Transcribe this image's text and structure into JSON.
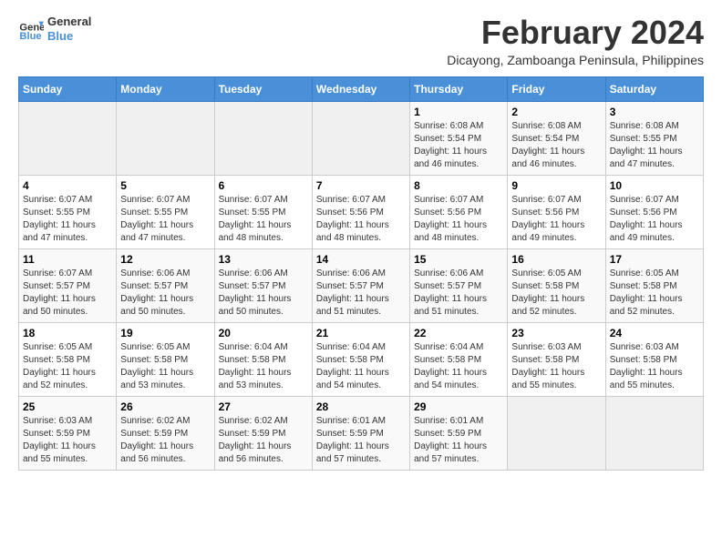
{
  "header": {
    "logo_line1": "General",
    "logo_line2": "Blue",
    "main_title": "February 2024",
    "subtitle": "Dicayong, Zamboanga Peninsula, Philippines"
  },
  "days_of_week": [
    "Sunday",
    "Monday",
    "Tuesday",
    "Wednesday",
    "Thursday",
    "Friday",
    "Saturday"
  ],
  "weeks": [
    [
      {
        "day": "",
        "info": ""
      },
      {
        "day": "",
        "info": ""
      },
      {
        "day": "",
        "info": ""
      },
      {
        "day": "",
        "info": ""
      },
      {
        "day": "1",
        "info": "Sunrise: 6:08 AM\nSunset: 5:54 PM\nDaylight: 11 hours and 46 minutes."
      },
      {
        "day": "2",
        "info": "Sunrise: 6:08 AM\nSunset: 5:54 PM\nDaylight: 11 hours and 46 minutes."
      },
      {
        "day": "3",
        "info": "Sunrise: 6:08 AM\nSunset: 5:55 PM\nDaylight: 11 hours and 47 minutes."
      }
    ],
    [
      {
        "day": "4",
        "info": "Sunrise: 6:07 AM\nSunset: 5:55 PM\nDaylight: 11 hours and 47 minutes."
      },
      {
        "day": "5",
        "info": "Sunrise: 6:07 AM\nSunset: 5:55 PM\nDaylight: 11 hours and 47 minutes."
      },
      {
        "day": "6",
        "info": "Sunrise: 6:07 AM\nSunset: 5:55 PM\nDaylight: 11 hours and 48 minutes."
      },
      {
        "day": "7",
        "info": "Sunrise: 6:07 AM\nSunset: 5:56 PM\nDaylight: 11 hours and 48 minutes."
      },
      {
        "day": "8",
        "info": "Sunrise: 6:07 AM\nSunset: 5:56 PM\nDaylight: 11 hours and 48 minutes."
      },
      {
        "day": "9",
        "info": "Sunrise: 6:07 AM\nSunset: 5:56 PM\nDaylight: 11 hours and 49 minutes."
      },
      {
        "day": "10",
        "info": "Sunrise: 6:07 AM\nSunset: 5:56 PM\nDaylight: 11 hours and 49 minutes."
      }
    ],
    [
      {
        "day": "11",
        "info": "Sunrise: 6:07 AM\nSunset: 5:57 PM\nDaylight: 11 hours and 50 minutes."
      },
      {
        "day": "12",
        "info": "Sunrise: 6:06 AM\nSunset: 5:57 PM\nDaylight: 11 hours and 50 minutes."
      },
      {
        "day": "13",
        "info": "Sunrise: 6:06 AM\nSunset: 5:57 PM\nDaylight: 11 hours and 50 minutes."
      },
      {
        "day": "14",
        "info": "Sunrise: 6:06 AM\nSunset: 5:57 PM\nDaylight: 11 hours and 51 minutes."
      },
      {
        "day": "15",
        "info": "Sunrise: 6:06 AM\nSunset: 5:57 PM\nDaylight: 11 hours and 51 minutes."
      },
      {
        "day": "16",
        "info": "Sunrise: 6:05 AM\nSunset: 5:58 PM\nDaylight: 11 hours and 52 minutes."
      },
      {
        "day": "17",
        "info": "Sunrise: 6:05 AM\nSunset: 5:58 PM\nDaylight: 11 hours and 52 minutes."
      }
    ],
    [
      {
        "day": "18",
        "info": "Sunrise: 6:05 AM\nSunset: 5:58 PM\nDaylight: 11 hours and 52 minutes."
      },
      {
        "day": "19",
        "info": "Sunrise: 6:05 AM\nSunset: 5:58 PM\nDaylight: 11 hours and 53 minutes."
      },
      {
        "day": "20",
        "info": "Sunrise: 6:04 AM\nSunset: 5:58 PM\nDaylight: 11 hours and 53 minutes."
      },
      {
        "day": "21",
        "info": "Sunrise: 6:04 AM\nSunset: 5:58 PM\nDaylight: 11 hours and 54 minutes."
      },
      {
        "day": "22",
        "info": "Sunrise: 6:04 AM\nSunset: 5:58 PM\nDaylight: 11 hours and 54 minutes."
      },
      {
        "day": "23",
        "info": "Sunrise: 6:03 AM\nSunset: 5:58 PM\nDaylight: 11 hours and 55 minutes."
      },
      {
        "day": "24",
        "info": "Sunrise: 6:03 AM\nSunset: 5:58 PM\nDaylight: 11 hours and 55 minutes."
      }
    ],
    [
      {
        "day": "25",
        "info": "Sunrise: 6:03 AM\nSunset: 5:59 PM\nDaylight: 11 hours and 55 minutes."
      },
      {
        "day": "26",
        "info": "Sunrise: 6:02 AM\nSunset: 5:59 PM\nDaylight: 11 hours and 56 minutes."
      },
      {
        "day": "27",
        "info": "Sunrise: 6:02 AM\nSunset: 5:59 PM\nDaylight: 11 hours and 56 minutes."
      },
      {
        "day": "28",
        "info": "Sunrise: 6:01 AM\nSunset: 5:59 PM\nDaylight: 11 hours and 57 minutes."
      },
      {
        "day": "29",
        "info": "Sunrise: 6:01 AM\nSunset: 5:59 PM\nDaylight: 11 hours and 57 minutes."
      },
      {
        "day": "",
        "info": ""
      },
      {
        "day": "",
        "info": ""
      }
    ]
  ]
}
